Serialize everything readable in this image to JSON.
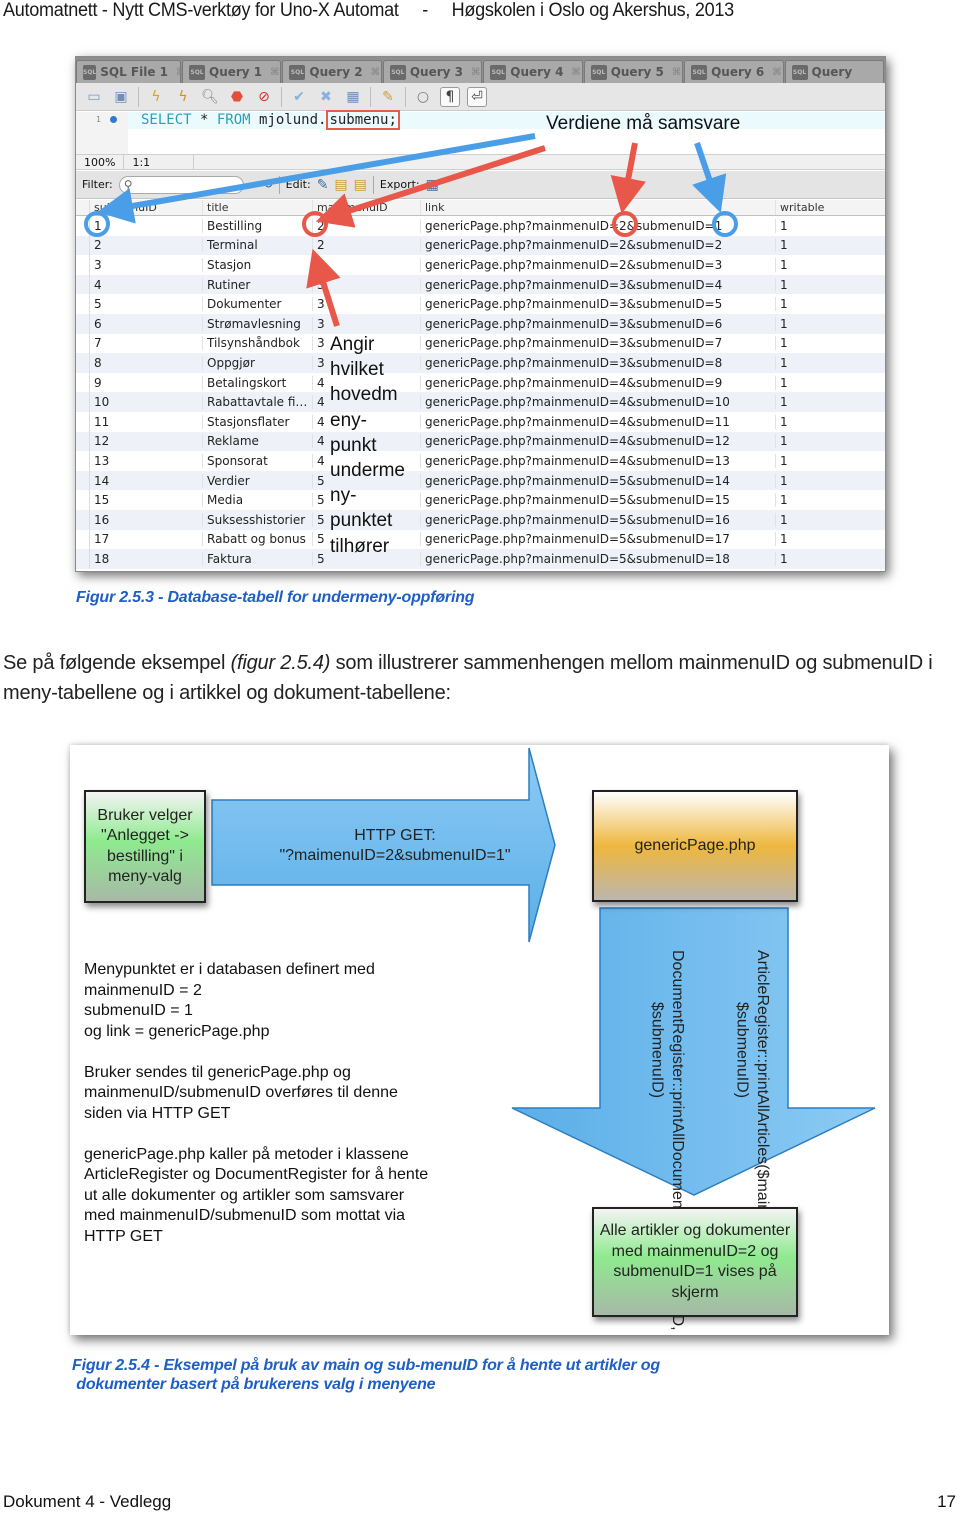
{
  "page": {
    "header": "Automatnett - Nytt CMS-verktøy for Uno-X Automat     -     Høgskolen i Oslo og Akershus, 2013",
    "footer_left": "Dokument 4 - Vedlegg",
    "footer_right": "17"
  },
  "figure1": {
    "tabs": [
      "SQL File 1",
      "Query 1",
      "Query 2",
      "Query 3",
      "Query 4",
      "Query 5",
      "Query 6",
      "Query"
    ],
    "toolbar_icons": [
      "folder-icon",
      "save-icon",
      "execute-icon",
      "execute-current-icon",
      "explain-icon",
      "stop-icon",
      "toggle-error-icon",
      "commit-icon",
      "rollback-icon",
      "autocommit-icon",
      "beautify-icon",
      "find-icon",
      "invisible-chars-icon",
      "wrap-icon"
    ],
    "editor": {
      "line_number": "1",
      "sql_keyword1": "SELECT",
      "sql_star": " * ",
      "sql_keyword2": "FROM",
      "sql_schema": " mjolund.",
      "sql_table": "submenu;"
    },
    "status": {
      "zoom": "100%",
      "position": "1:1"
    },
    "filterbar": {
      "filter_label": "Filter:",
      "edit_label": "Edit:",
      "export_label": "Export:"
    },
    "columns": [
      "submenuID",
      "title",
      "mainmenuID",
      "link",
      "writable"
    ],
    "rows": [
      [
        "1",
        "Bestilling",
        "2",
        "genericPage.php?mainmenuID=2&submenuID=1",
        "1"
      ],
      [
        "2",
        "Terminal",
        "2",
        "genericPage.php?mainmenuID=2&submenuID=2",
        "1"
      ],
      [
        "3",
        "Stasjon",
        "2",
        "genericPage.php?mainmenuID=2&submenuID=3",
        "1"
      ],
      [
        "4",
        "Rutiner",
        "3",
        "genericPage.php?mainmenuID=3&submenuID=4",
        "1"
      ],
      [
        "5",
        "Dokumenter",
        "3",
        "genericPage.php?mainmenuID=3&submenuID=5",
        "1"
      ],
      [
        "6",
        "Strømavlesning",
        "3",
        "genericPage.php?mainmenuID=3&submenuID=6",
        "1"
      ],
      [
        "7",
        "Tilsynshåndbok",
        "3",
        "genericPage.php?mainmenuID=3&submenuID=7",
        "1"
      ],
      [
        "8",
        "Oppgjør",
        "3",
        "genericPage.php?mainmenuID=3&submenuID=8",
        "1"
      ],
      [
        "9",
        "Betalingskort",
        "4",
        "genericPage.php?mainmenuID=4&submenuID=9",
        "1"
      ],
      [
        "10",
        "Rabattavtale fi…",
        "4",
        "genericPage.php?mainmenuID=4&submenuID=10",
        "1"
      ],
      [
        "11",
        "Stasjonsflater",
        "4",
        "genericPage.php?mainmenuID=4&submenuID=11",
        "1"
      ],
      [
        "12",
        "Reklame",
        "4",
        "genericPage.php?mainmenuID=4&submenuID=12",
        "1"
      ],
      [
        "13",
        "Sponsorat",
        "4",
        "genericPage.php?mainmenuID=4&submenuID=13",
        "1"
      ],
      [
        "14",
        "Verdier",
        "5",
        "genericPage.php?mainmenuID=5&submenuID=14",
        "1"
      ],
      [
        "15",
        "Media",
        "5",
        "genericPage.php?mainmenuID=5&submenuID=15",
        "1"
      ],
      [
        "16",
        "Suksesshistorier",
        "5",
        "genericPage.php?mainmenuID=5&submenuID=16",
        "1"
      ],
      [
        "17",
        "Rabatt og bonus",
        "5",
        "genericPage.php?mainmenuID=5&submenuID=17",
        "1"
      ],
      [
        "18",
        "Faktura",
        "5",
        "genericPage.php?mainmenuID=5&submenuID=18",
        "1"
      ]
    ],
    "annotation_title": "Verdiene må samsvare",
    "annotation_side": [
      "Angir",
      "hvilket",
      "hovedm",
      "eny-",
      "punkt",
      "underme",
      "ny-",
      "punktet",
      "tilhører"
    ],
    "annotation_colors": {
      "red": "#e8584a",
      "blue": "#4a9ee8"
    },
    "caption": "Figur 2.5.3 - Database-tabell for undermeny-oppføring"
  },
  "body": {
    "text_before": "Se på følgende eksempel ",
    "text_italic": "(figur 2.5.4)",
    "text_after": " som illustrerer sammenhengen mellom mainmenuID og submenuID i meny-tabellene og i artikkel og dokument-tabellene:"
  },
  "figure2": {
    "box_user": "Bruker velger \"Anlegget -> bestilling\" i meny-valg",
    "arrow_http": "HTTP GET:\n\"?maimenuID=2&submenuID=1\"",
    "box_page": "genericPage.php",
    "description": "Menypunktet er i databasen definert med\nmainmenuID = 2\nsubmenuID = 1\nog link = genericPage.php\n\nBruker sendes til genericPage.php og\nmainmenuID/submenuID overføres til denne\nsiden via HTTP GET\n\ngenericPage.php kaller på metoder i klassene\nArticleRegister og DocumentRegister for å hente\nut alle dokumenter og artikler som samsvarer\nmed mainmenuID/submenuID som mottat via\nHTTP GET",
    "method_articles": "ArticleRegister::printAllArticles($mainmenuID, $submenuID)",
    "method_documents": "DocumentRegister::printAllDocuments($mainmenuID, $submenuID)",
    "box_result": "Alle artikler og dokumenter med mainmenuID=2 og submenuID=1 vises på skjerm",
    "caption_line1": "Figur 2.5.4 - Eksempel på bruk av main og sub-menuID for å hente ut artikler og",
    "caption_line2": " dokumenter basert på brukerens valg i menyene",
    "colors": {
      "arrow_fill": "#7cc0ef",
      "arrow_stroke": "#2b7fc1",
      "caption": "#1f5fc4"
    }
  }
}
